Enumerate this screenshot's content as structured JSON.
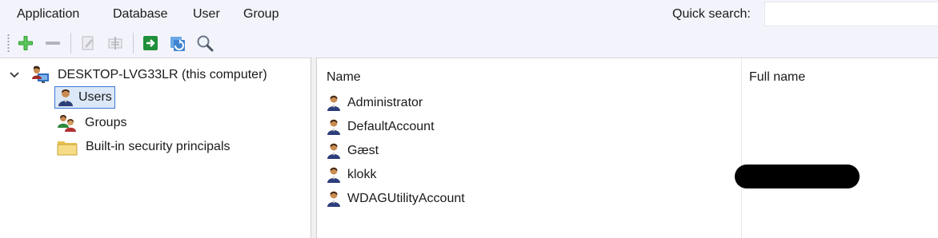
{
  "menu": {
    "application": "Application",
    "database": "Database",
    "user": "User",
    "group": "Group"
  },
  "quick_search": {
    "label": "Quick search:",
    "value": "",
    "placeholder": ""
  },
  "toolbar": {
    "icons": [
      "add-icon",
      "remove-icon",
      "edit-icon",
      "properties-icon",
      "export-icon",
      "refresh-icon",
      "search-icon"
    ]
  },
  "tree": {
    "computer": "DESKTOP-LVG33LR (this computer)",
    "items": [
      {
        "label": "Users",
        "icon": "user-icon",
        "selected": true
      },
      {
        "label": "Groups",
        "icon": "group-icon",
        "selected": false
      },
      {
        "label": "Built-in security principals",
        "icon": "folder-icon",
        "selected": false
      }
    ]
  },
  "list": {
    "columns": [
      "Name",
      "Full name"
    ],
    "rows": [
      {
        "name": "Administrator",
        "full_name": ""
      },
      {
        "name": "DefaultAccount",
        "full_name": ""
      },
      {
        "name": "Gæst",
        "full_name": ""
      },
      {
        "name": "klokk",
        "full_name": "",
        "redacted": true
      },
      {
        "name": "WDAGUtilityAccount",
        "full_name": ""
      }
    ]
  },
  "colors": {
    "bar_background": "#f3f4fb",
    "selection_border": "#3b78d8",
    "selection_fill": "#dce8f7",
    "add_green": "#2e9e2e"
  }
}
